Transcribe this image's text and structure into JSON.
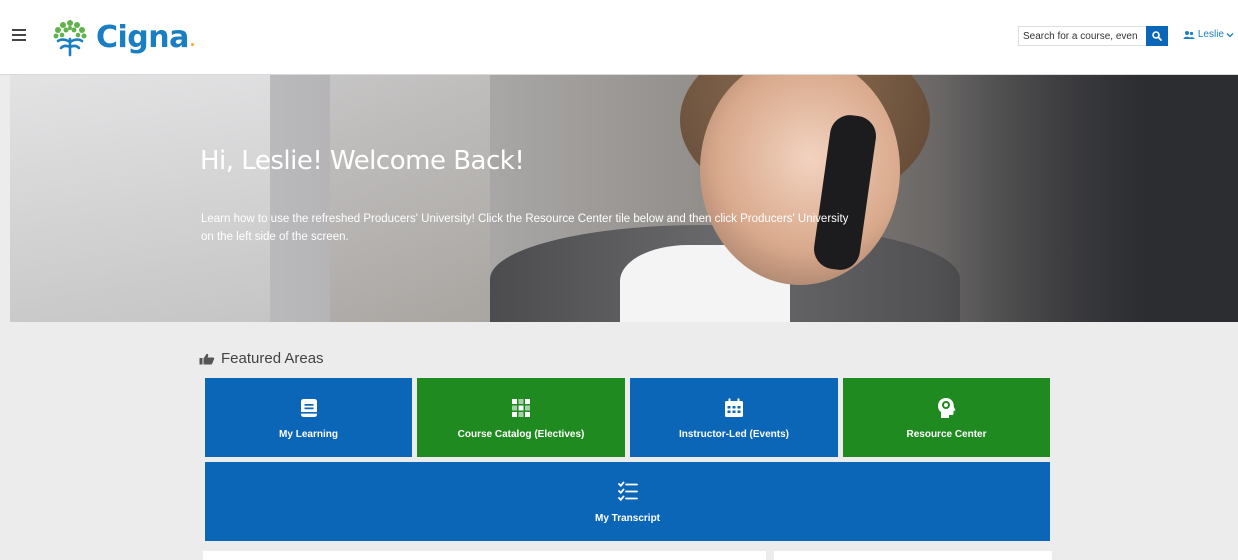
{
  "header": {
    "brand": "Cigna",
    "brand_dot": ".",
    "search_placeholder": "Search for a course, even",
    "user_name": "Leslie",
    "colors": {
      "brand": "#1a7fc2",
      "accent": "#f5a623",
      "search_button": "#0b66b7"
    }
  },
  "hero": {
    "title": "Hi, Leslie! Welcome Back!",
    "description": "Learn how to use the refreshed Producers' University! Click the Resource Center tile below and then click Producers' University on the left side of the screen."
  },
  "featured": {
    "heading": "Featured Areas",
    "icon": "thumbs-up-icon",
    "tiles": [
      {
        "label": "My Learning",
        "icon": "book-icon",
        "color": "#0b66b7"
      },
      {
        "label": "Course Catalog (Electives)",
        "icon": "grid-icon",
        "color": "#1f8a1f"
      },
      {
        "label": "Instructor-Led (Events)",
        "icon": "calendar-icon",
        "color": "#0b66b7"
      },
      {
        "label": "Resource Center",
        "icon": "brain-head-icon",
        "color": "#1f8a1f"
      },
      {
        "label": "My Transcript",
        "icon": "checklist-icon",
        "color": "#0b66b7"
      }
    ]
  }
}
